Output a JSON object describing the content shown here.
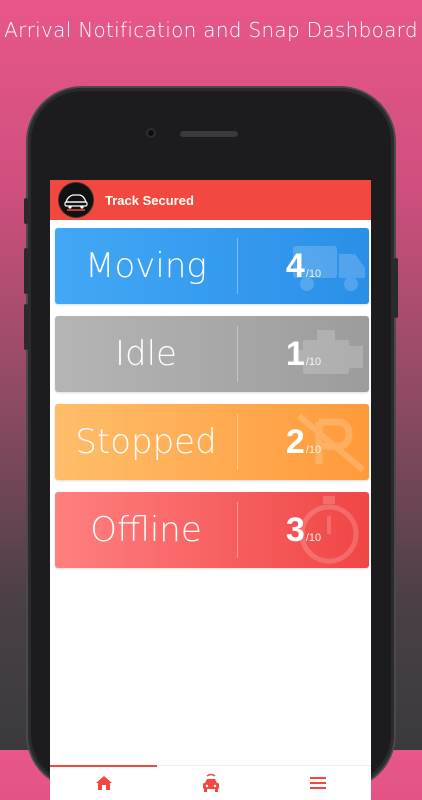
{
  "promo": {
    "title": "Arrival Notification and Snap Dashboard"
  },
  "header": {
    "title": "Track Secured",
    "logo_icon": "car-logo-icon"
  },
  "cards": [
    {
      "label": "Moving",
      "count": "4",
      "total": "/10",
      "color": "#2a8fe8",
      "icon": "truck-icon"
    },
    {
      "label": "Idle",
      "count": "1",
      "total": "/10",
      "color": "#9c9c9c",
      "icon": "engine-icon"
    },
    {
      "label": "Stopped",
      "count": "2",
      "total": "/10",
      "color": "#ff9a3a",
      "icon": "no-parking-icon"
    },
    {
      "label": "Offline",
      "count": "3",
      "total": "/10",
      "color": "#f04545",
      "icon": "stopwatch-icon"
    }
  ],
  "nav": {
    "items": [
      {
        "icon": "home-icon",
        "active": true
      },
      {
        "icon": "taxi-icon",
        "active": false
      },
      {
        "icon": "menu-icon",
        "active": false
      }
    ],
    "accent": "#f2483f"
  }
}
